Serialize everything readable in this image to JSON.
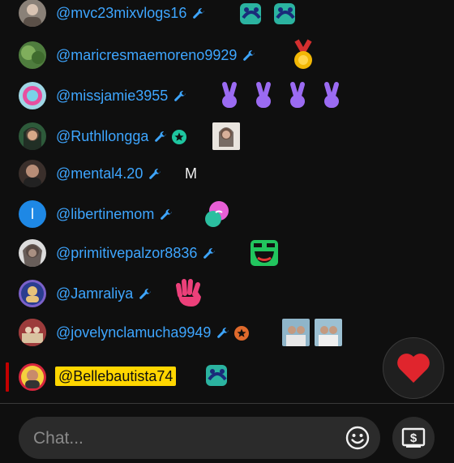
{
  "messages": [
    {
      "author": "@mvc23mixvlogs16",
      "content": ""
    },
    {
      "author": "@maricresmaemoreno9929",
      "content": ""
    },
    {
      "author": "@missjamie3955",
      "content": ""
    },
    {
      "author": "@Ruthllongga",
      "content": ""
    },
    {
      "author": "@mental4.20",
      "content": "M"
    },
    {
      "author": "@libertinemom",
      "content": ""
    },
    {
      "author": "@primitivepalzor8836",
      "content": ""
    },
    {
      "author": "@Jamraliya",
      "content": ""
    },
    {
      "author": "@jovelynclamucha9949",
      "content": ""
    }
  ],
  "pinned": {
    "author": "@Bellebautista74"
  },
  "avatars": {
    "libertine_letter": "l"
  },
  "input": {
    "placeholder": "Chat..."
  },
  "colors": {
    "author_blue": "#3ea6ff",
    "owner_yellow": "#ffd600",
    "heart_red": "#e0252d",
    "background": "#0f0f0f"
  },
  "icons": [
    "wrench-icon",
    "member-star-icon",
    "smiley-icon",
    "super-chat-icon",
    "heart-icon",
    "peace-sign-emoji",
    "medal-emoji",
    "wave-hand-emoji"
  ]
}
